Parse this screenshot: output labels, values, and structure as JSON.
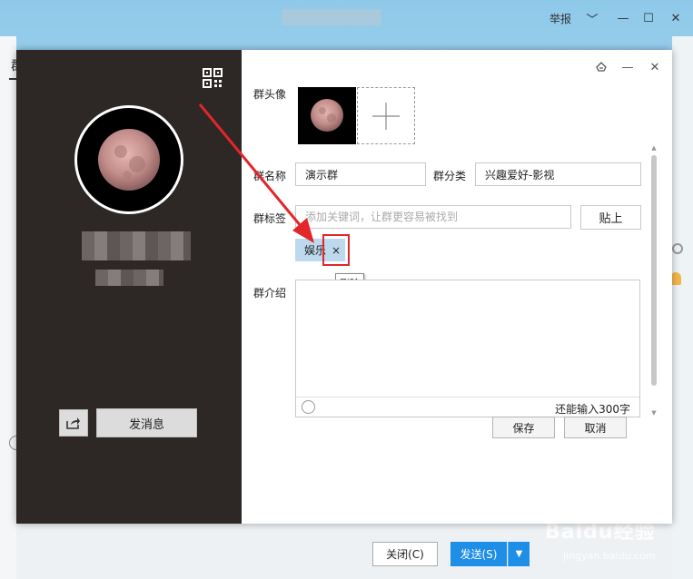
{
  "background_window": {
    "report_label": "举报",
    "left_tab_text": "群",
    "close_button": "关闭(C)",
    "send_button": "发送(S)",
    "watermark": "Baidu经验",
    "watermark_sub": "jingyan.baidu.com"
  },
  "profile_panel": {
    "send_message_button": "发消息"
  },
  "form": {
    "avatar_label": "群头像",
    "name_label": "群名称",
    "name_value": "演示群",
    "category_label": "群分类",
    "category_value": "兴趣爱好-影视",
    "tags_label": "群标签",
    "tags_placeholder": "添加关键词，让群更容易被找到",
    "paste_button": "贴上",
    "tag_item": "娱乐",
    "tag_delete_symbol": "×",
    "delete_tooltip": "删除",
    "intro_label": "群介绍",
    "intro_value": "",
    "remaining_chars": "还能输入300字",
    "save_button": "保存",
    "cancel_button": "取消"
  },
  "colors": {
    "left_panel_bg": "#2d2725",
    "tag_bg": "#bdd9ee",
    "highlight_red": "#e2262a",
    "send_blue": "#1e8ee6"
  }
}
